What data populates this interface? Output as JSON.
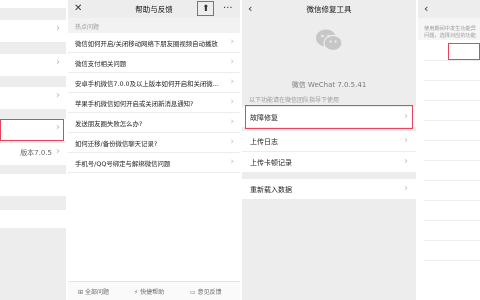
{
  "colors": {
    "highlight": "#e8435a",
    "bar": "#ededed",
    "chevron": "#c0c0c0"
  },
  "panel1": {
    "version_text": "版本7.0.5"
  },
  "panel2": {
    "close_icon": "close-icon",
    "title": "帮助与反馈",
    "pin_icon": "pin-icon",
    "more_icon": "more-icon",
    "section_label": "热点问题",
    "questions": [
      "微信如何开启/关闭移动网络下朋友圈视频自动播放",
      "微信支付相关问题",
      "安卓手机微信7.0.0及以上版本如何开启和关闭微...",
      "苹果手机微信如何开启或关闭新消息通知?",
      "发送朋友圈失败怎么办?",
      "如何迁移/备份微信聊天记录?",
      "手机号/QQ号绑定与解绑微信问题"
    ],
    "footer": [
      "全部问题",
      "快捷帮助",
      "意见反馈"
    ]
  },
  "panel3": {
    "back_icon": "back-chevron-icon",
    "title": "微信修复工具",
    "app_name": "微信 WeChat 7.0.5.41",
    "hint": "以下功能请在微信团队指导下使用",
    "items": [
      "故障修复",
      "上传日志",
      "上传卡顿记录",
      "重新载入数据"
    ]
  },
  "panel4": {
    "back_icon": "back-chevron-icon",
    "description": [
      "使用期间中发生功能异",
      "问题，选择对应的功能"
    ]
  }
}
